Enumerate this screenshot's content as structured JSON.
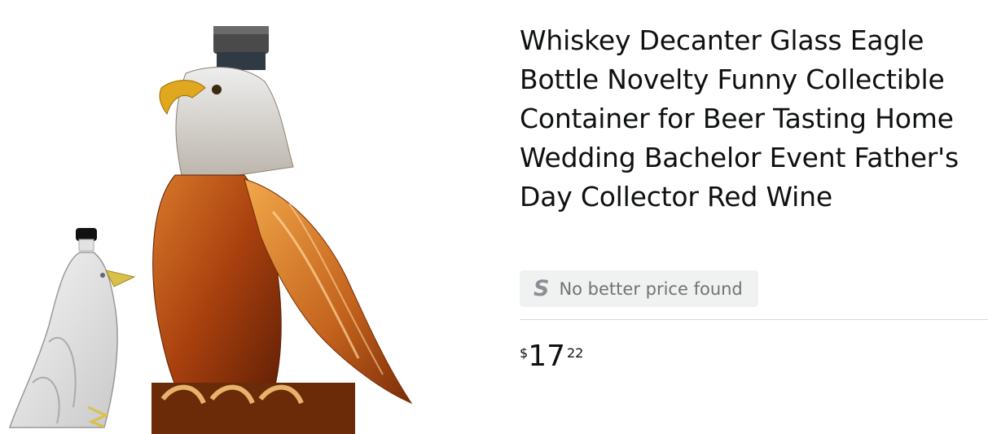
{
  "product": {
    "title": "Whiskey Decanter Glass Eagle Bottle Novelty Funny Collectible Container for Beer Tasting Home Wedding Bachelor Event Father's Day Collector Red Wine",
    "image_alt": "eagle-shaped whiskey decanter product photo"
  },
  "price_badge": {
    "icon": "S",
    "text": "No better price found"
  },
  "price": {
    "symbol": "$",
    "whole": "17",
    "fraction": "22"
  },
  "colors": {
    "title": "#0f1111",
    "badge_bg": "#f0f2f2",
    "badge_text": "#6f7373",
    "amber": "#b5561a"
  }
}
